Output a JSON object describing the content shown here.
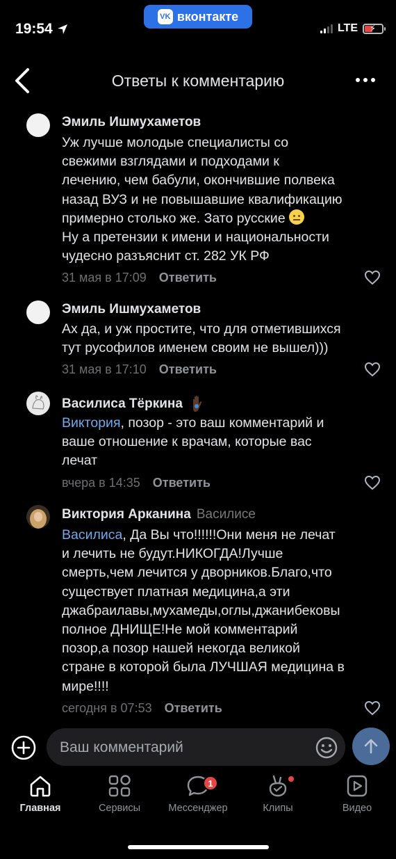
{
  "status_bar": {
    "time": "19:54",
    "app_badge": "вконтакте",
    "network": "LTE"
  },
  "header": {
    "title": "Ответы к комментарию"
  },
  "comments": [
    {
      "author": "Эмиль Ишмухаметов",
      "lines": [
        "Уж лучше молодые специалисты со",
        "свежими взглядами и подходами к",
        "лечению, чем бабули, окончившие полвека",
        "назад ВУЗ и не повышавшие квалификацию",
        "примерно столько же. Зато русские",
        "Ну а претензии к имени и национальности",
        "чудесно разъяснит ст. 282 УК РФ"
      ],
      "time": "31 мая в 17:09",
      "reply": "Ответить"
    },
    {
      "author": "Эмиль Ишмухаметов",
      "lines": [
        "Ах да, и уж простите, что для отметившихся",
        "тут русофилов именем своим не вышел)))"
      ],
      "time": "31 мая в 17:10",
      "reply": "Ответить"
    },
    {
      "author": "Василиса Тёркина",
      "mention": "Виктория",
      "lines": [
        ", позор - это ваш комментарий и",
        "ваше отношение к врачам, которые вас",
        "лечат"
      ],
      "time": "вчера в 14:35",
      "reply": "Ответить"
    },
    {
      "author": "Виктория Арканина",
      "reply_to": "Василисе",
      "mention": "Василиса",
      "lines": [
        ", Да Вы что!!!!!!Они меня не лечат",
        "и лечить не будут.НИКОГДА!Лучше",
        "смерть,чем лечится у дворников.Благо,что",
        "существует платная медицина,а эти",
        "джабраилавы,мухамеды,оглы,джанибековы",
        "полное ДНИЩЕ!Не мой комментарий",
        "позор,а позор нашей некогда великой",
        "стране в которой была ЛУЧШАЯ медицина в",
        "мире!!!!"
      ],
      "time": "сегодня в 07:53",
      "reply": "Ответить"
    }
  ],
  "input": {
    "placeholder": "Ваш комментарий"
  },
  "tabs": [
    {
      "label": "Главная",
      "icon": "home-icon",
      "active": true
    },
    {
      "label": "Сервисы",
      "icon": "services-icon"
    },
    {
      "label": "Мессенджер",
      "icon": "messenger-icon",
      "badge": "1"
    },
    {
      "label": "Клипы",
      "icon": "clips-icon"
    },
    {
      "label": "Видео",
      "icon": "video-icon"
    }
  ],
  "colors": {
    "accent": "#2c72e6",
    "mention": "#71aaeb",
    "badge": "#e64646",
    "send": "#4b6b99"
  }
}
